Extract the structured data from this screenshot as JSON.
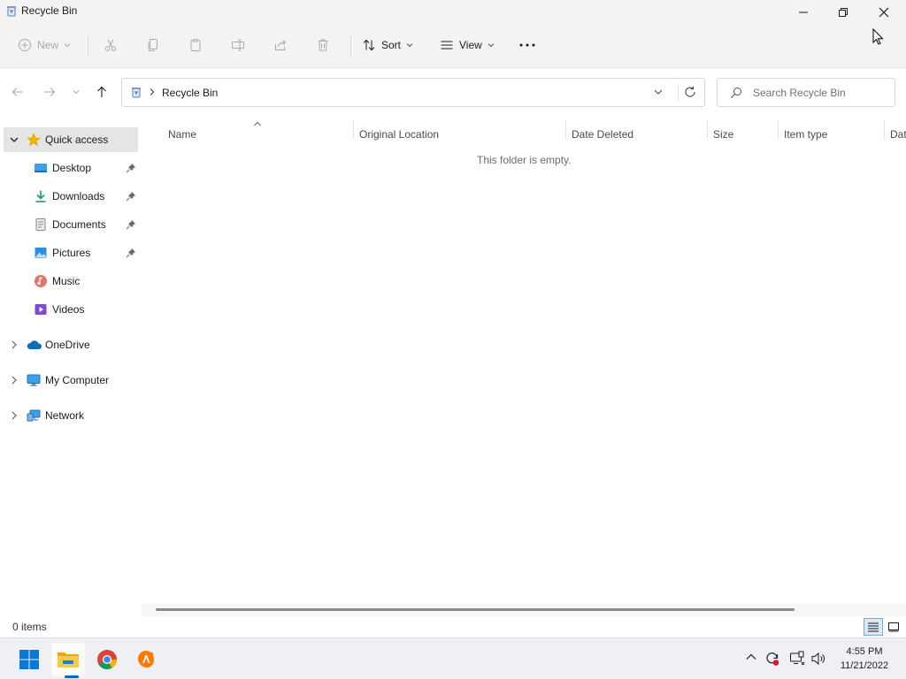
{
  "window": {
    "title": "Recycle Bin"
  },
  "toolbar": {
    "new_label": "New",
    "sort_label": "Sort",
    "view_label": "View"
  },
  "address": {
    "crumb": "Recycle Bin",
    "search_placeholder": "Search Recycle Bin"
  },
  "sidebar": {
    "quick_access": "Quick access",
    "items": [
      {
        "label": "Desktop"
      },
      {
        "label": "Downloads"
      },
      {
        "label": "Documents"
      },
      {
        "label": "Pictures"
      },
      {
        "label": "Music"
      },
      {
        "label": "Videos"
      }
    ],
    "onedrive": "OneDrive",
    "my_computer": "My Computer",
    "network": "Network"
  },
  "columns": [
    "Name",
    "Original Location",
    "Date Deleted",
    "Size",
    "Item type",
    "Dat"
  ],
  "content": {
    "empty_message": "This folder is empty."
  },
  "status": {
    "items_count": "0 items"
  },
  "clock": {
    "time": "4:55 PM",
    "date": "11/21/2022"
  },
  "colors": {
    "accent": "#0067c0",
    "selection": "#e5e5e5",
    "folder_yellow": "#f2c14e"
  }
}
